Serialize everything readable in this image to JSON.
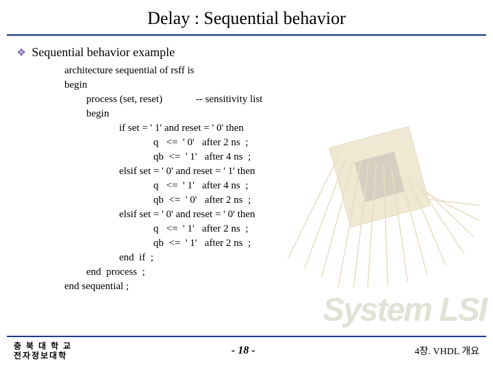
{
  "title": "Delay : Sequential behavior",
  "bullet": "Sequential behavior example",
  "code": {
    "l1": "architecture sequential of rsff is",
    "l2": "begin",
    "l3": "process (set, reset)             -- sensitivity list",
    "l4": "begin",
    "l5": "if set = ' 1' and reset = ' 0' then",
    "l6": "q   <=  ' 0'   after 2 ns  ;",
    "l7": "qb  <=  ' 1'   after 4 ns  ;",
    "l8": "elsif set = ' 0' and reset = ' 1' then",
    "l9": "q   <=  ' 1'   after 4 ns  ;",
    "l10": "qb  <=  ' 0'   after 2 ns  ;",
    "l11": "elsif set = ' 0' and reset = ' 0' then",
    "l12": "q   <=  ' 1'   after 2 ns  ;",
    "l13": "qb  <=  ' 1'   after 2 ns  ;",
    "l14": "end  if  ;",
    "l15": "end  process  ;",
    "l16": "end sequential ;"
  },
  "footer": {
    "org1": "충 북 대 학 교",
    "org2": "전자정보대학",
    "page": "-  18  -",
    "chapter": "4장. VHDL 개요"
  },
  "bg_text": "System LSI"
}
